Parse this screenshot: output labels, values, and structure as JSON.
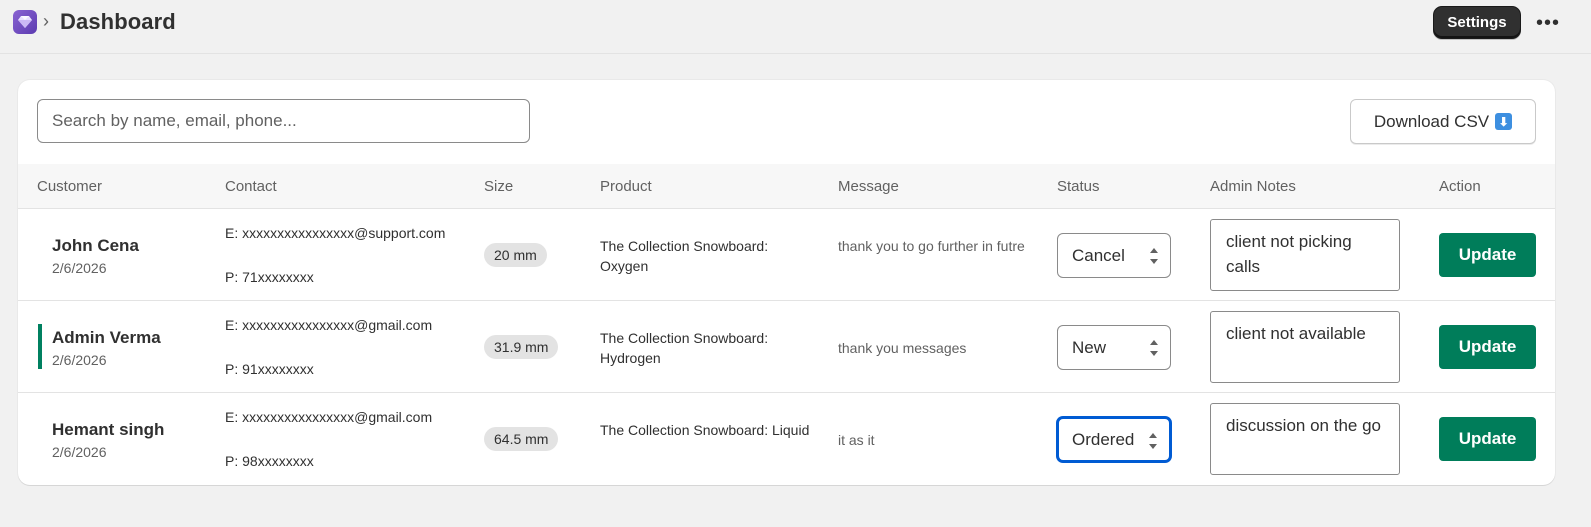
{
  "header": {
    "breadcrumb_separator": "›",
    "title": "Dashboard",
    "settings_label": "Settings",
    "more_label": "•••",
    "app_icon": "gem-icon",
    "app_icon_color": "#7b54c9"
  },
  "toolbar": {
    "search_placeholder": "Search by name, email, phone...",
    "search_value": "",
    "download_label": "Download CSV",
    "download_icon": "down-arrow-emoji-icon",
    "download_icon_glyph": "⬇"
  },
  "table": {
    "columns": [
      "Customer",
      "Contact",
      "Size",
      "Product",
      "Message",
      "Status",
      "Admin Notes",
      "Action"
    ],
    "rows": [
      {
        "name": "John Cena",
        "date": "2/6/2026",
        "email": "E: xxxxxxxxxxxxxxxx@support.com",
        "phone": "P: 71xxxxxxxx",
        "size": "20 mm",
        "product": "The Collection Snowboard: Oxygen",
        "message": "thank you to go further in futre",
        "status": "Cancel",
        "notes": "client not picking calls",
        "action": "Update",
        "highlighted": false,
        "status_focused": false
      },
      {
        "name": "Admin Verma",
        "date": "2/6/2026",
        "email": "E: xxxxxxxxxxxxxxxx@gmail.com",
        "phone": "P: 91xxxxxxxx",
        "size": "31.9 mm",
        "product": "The Collection Snowboard: Hydrogen",
        "message": "thank you messages",
        "status": "New",
        "notes": "client not available",
        "action": "Update",
        "highlighted": true,
        "status_focused": false
      },
      {
        "name": "Hemant singh",
        "date": "2/6/2026",
        "email": "E: xxxxxxxxxxxxxxxx@gmail.com",
        "phone": "P: 98xxxxxxxx",
        "size": "64.5 mm",
        "product": "The Collection Snowboard: Liquid",
        "message": "it as it",
        "status": "Ordered",
        "notes": "discussion on the go",
        "action": "Update",
        "highlighted": false,
        "status_focused": true
      }
    ]
  },
  "colors": {
    "primary_green": "#007d5a",
    "accent_bar": "#008060",
    "focus_blue": "#005bd3",
    "settings_dark": "#303030",
    "page_bg": "#f1f1f1"
  }
}
